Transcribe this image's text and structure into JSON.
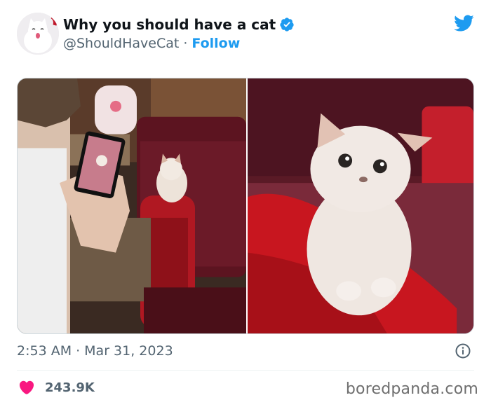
{
  "tweet": {
    "display_name": "Why you should have a cat",
    "handle": "@ShouldHaveCat",
    "separator": "·",
    "follow_label": "Follow",
    "time": "2:53 AM",
    "date": "Mar 31, 2023",
    "like_count": "243.9K"
  },
  "icons": {
    "verified": "verified-badge-icon",
    "logo": "twitter-bird-icon",
    "info": "info-icon",
    "like": "heart-icon"
  },
  "colors": {
    "accent": "#1d9bf0",
    "like": "#f91880",
    "muted_text": "#536471"
  },
  "watermark": "boredpanda.com"
}
